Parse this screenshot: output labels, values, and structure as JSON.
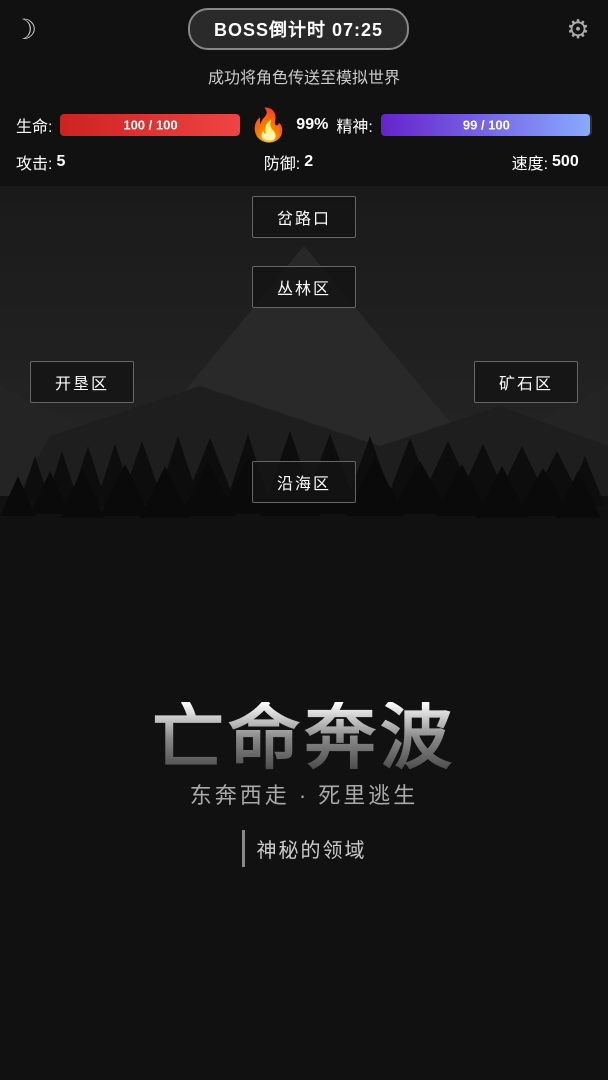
{
  "header": {
    "boss_timer_label": "BOSS倒计时 07:25",
    "moon_icon": "☽",
    "settings_icon": "⚙"
  },
  "status": {
    "message": "成功将角色传送至模拟世界"
  },
  "stats": {
    "hp_label": "生命:",
    "hp_current": "100",
    "hp_max": "100",
    "hp_bar_value": "100",
    "hp_bar_text": "100 / 100",
    "hp_percent": "99%",
    "mp_label": "精神:",
    "mp_current": "99",
    "mp_max": "100",
    "mp_bar_value": "99",
    "mp_bar_text": "99 / 100",
    "atk_label": "攻击:",
    "atk_value": "5",
    "def_label": "防御:",
    "def_value": "2",
    "spd_label": "速度:",
    "spd_value": "500"
  },
  "areas": {
    "crossroads": "岔路口",
    "jungle": "丛林区",
    "reclaim": "开垦区",
    "mine": "矿石区",
    "coastal": "沿海区"
  },
  "branding": {
    "title_main": "亡命奔波",
    "title_sub": "东奔西走 · 死里逃生",
    "mystery_zone": "神秘的领域"
  }
}
